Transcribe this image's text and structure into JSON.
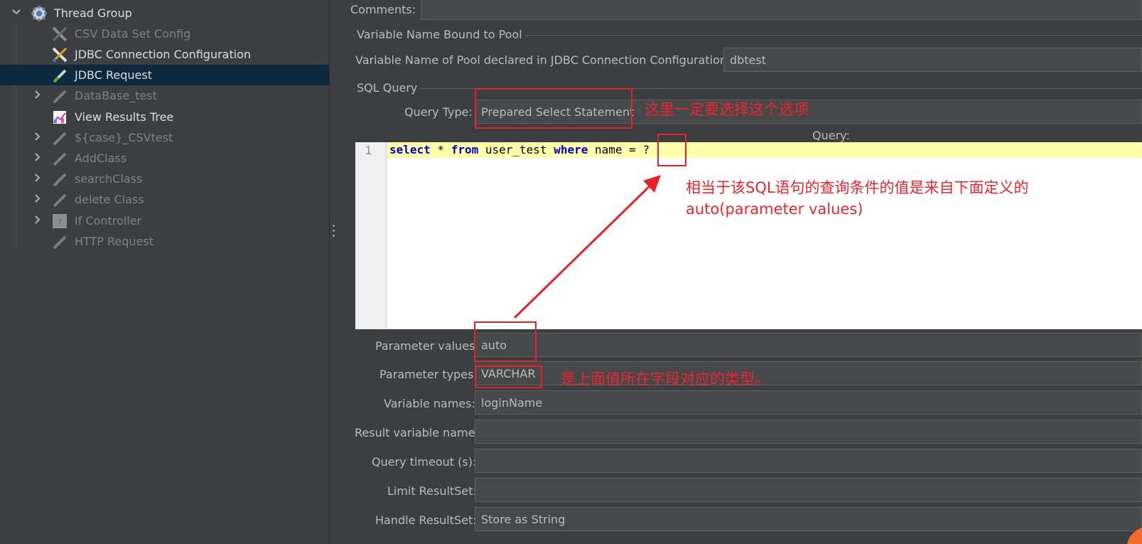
{
  "tree": {
    "items": [
      {
        "label": "Thread Group",
        "icon": "gear-icon",
        "state": "enabled",
        "arrow": "expanded"
      },
      {
        "label": "CSV Data Set Config",
        "icon": "wrench-screwdriver-icon",
        "state": "disabled",
        "arrow": ""
      },
      {
        "label": "JDBC Connection Configuration",
        "icon": "wrench-screwdriver-icon",
        "state": "enabled",
        "arrow": ""
      },
      {
        "label": "JDBC Request",
        "icon": "pipette-icon",
        "state": "enabled",
        "arrow": "",
        "selected": true
      },
      {
        "label": "DataBase_test",
        "icon": "pipette-icon",
        "state": "disabled",
        "arrow": "collapsed"
      },
      {
        "label": "View Results Tree",
        "icon": "chart-icon",
        "state": "enabled",
        "arrow": ""
      },
      {
        "label": "${case}_CSVtest",
        "icon": "pipette-icon",
        "state": "disabled",
        "arrow": "collapsed"
      },
      {
        "label": "AddClass",
        "icon": "pipette-icon",
        "state": "disabled",
        "arrow": "collapsed"
      },
      {
        "label": "searchClass",
        "icon": "pipette-icon",
        "state": "disabled",
        "arrow": "collapsed"
      },
      {
        "label": "delete Class",
        "icon": "pipette-icon",
        "state": "disabled",
        "arrow": "collapsed"
      },
      {
        "label": "If Controller",
        "icon": "controller-icon",
        "state": "disabled",
        "arrow": "collapsed"
      },
      {
        "label": "HTTP Request",
        "icon": "pipette-icon",
        "state": "disabled",
        "arrow": ""
      }
    ]
  },
  "form": {
    "comments_label": "Comments:",
    "comments_value": "",
    "pool_group_title": "Variable Name Bound to Pool",
    "pool_label": "Variable Name of Pool declared in JDBC Connection Configuration:",
    "pool_value": "dbtest",
    "sql_group_title": "SQL Query",
    "query_type_label": "Query Type:",
    "query_type_value": "Prepared Select Statement",
    "query_label": "Query:",
    "editor": {
      "line_number": "1",
      "kw_select": "select",
      "txt_star": " * ",
      "kw_from": "from",
      "txt_table": " user_test ",
      "kw_where": "where",
      "txt_cond": " name = ",
      "txt_param": "?"
    },
    "param_values_label": "Parameter values:",
    "param_values_value": "auto",
    "param_types_label": "Parameter types:",
    "param_types_value": "VARCHAR",
    "var_names_label": "Variable names:",
    "var_names_value": "loginName",
    "result_var_label": "Result variable name:",
    "result_var_value": "",
    "timeout_label": "Query timeout (s):",
    "timeout_value": "",
    "limit_label": "Limit ResultSet:",
    "limit_value": "",
    "handle_label": "Handle ResultSet:",
    "handle_value": "Store as String"
  },
  "annotations": {
    "note_query_type": "这里一定要选择这个选项",
    "note_param_line1": "相当于该SQL语句的查询条件的值是来自下面定义的",
    "note_param_line2": "auto(parameter values)",
    "note_types": "是上面值所在字段对应的类型。",
    "color": "#e8202a"
  }
}
